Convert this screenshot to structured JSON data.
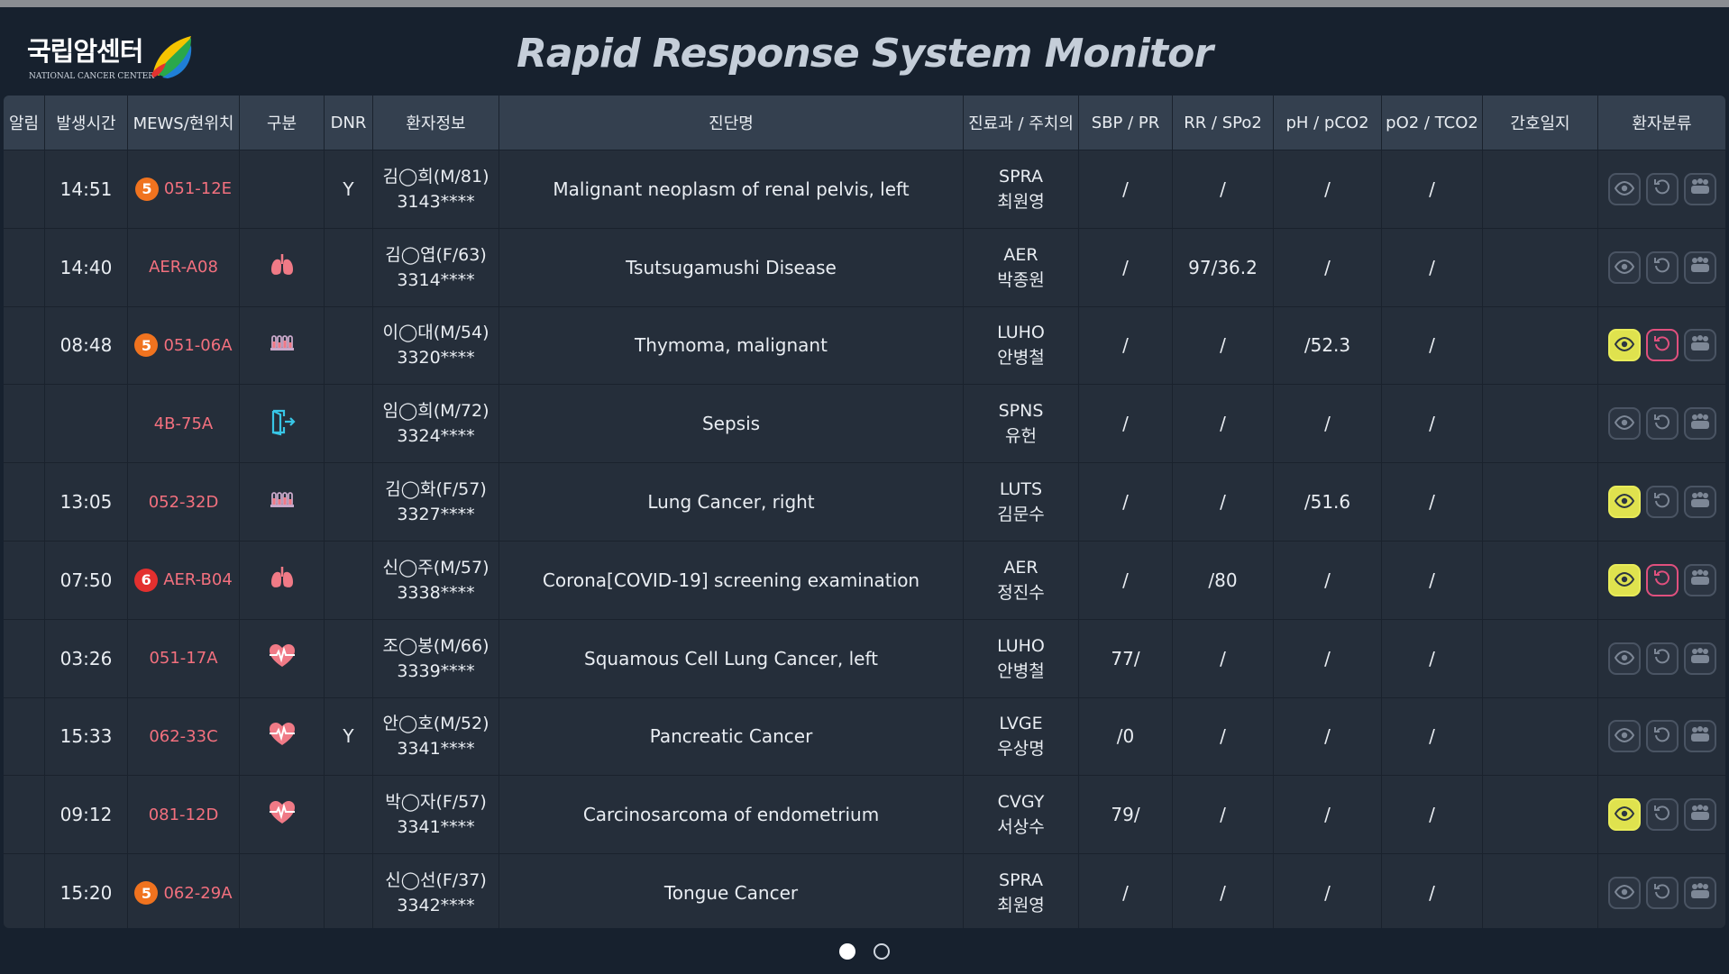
{
  "app": {
    "logo_ko": "국립암센터",
    "logo_en": "NATIONAL CANCER CENTER",
    "title": "Rapid Response System Monitor"
  },
  "colors": {
    "mews_orange": "#f0731f",
    "mews_red": "#e3302f",
    "location": "#f3707e",
    "eye_active": "#dfe24e",
    "reset_active": "#e0507e"
  },
  "columns": [
    "알림",
    "발생시간",
    "MEWS/현위치",
    "구분",
    "DNR",
    "환자정보",
    "진단명",
    "진료과 / 주치의",
    "SBP / PR",
    "RR / SPo2",
    "pH / pCO2",
    "pO2 / TCO2",
    "간호일지",
    "환자분류"
  ],
  "rows": [
    {
      "time": "14:51",
      "mews": "5",
      "mews_color": "orange",
      "location": "051-12E",
      "type_icon": "",
      "dnr": "Y",
      "patient": "김◯희(M/81)",
      "patient_id": "3143****",
      "diagnosis": "Malignant neoplasm of renal pelvis, left",
      "dept": "SPRA",
      "doctor": "최원영",
      "sbp_pr": "/",
      "rr_spo2": "/",
      "ph_pco2": "/",
      "po2_tco2": "/",
      "nursing": "",
      "eye_active": false,
      "reset_active": false
    },
    {
      "time": "14:40",
      "mews": "",
      "mews_color": "",
      "location": "AER-A08",
      "type_icon": "lungs-icon",
      "dnr": "",
      "patient": "김◯엽(F/63)",
      "patient_id": "3314****",
      "diagnosis": "Tsutsugamushi Disease",
      "dept": "AER",
      "doctor": "박종원",
      "sbp_pr": "/",
      "rr_spo2": "97/36.2",
      "ph_pco2": "/",
      "po2_tco2": "/",
      "nursing": "",
      "eye_active": false,
      "reset_active": false
    },
    {
      "time": "08:48",
      "mews": "5",
      "mews_color": "orange",
      "location": "051-06A",
      "type_icon": "test-tubes-icon",
      "dnr": "",
      "patient": "이◯대(M/54)",
      "patient_id": "3320****",
      "diagnosis": "Thymoma, malignant",
      "dept": "LUHO",
      "doctor": "안병철",
      "sbp_pr": "/",
      "rr_spo2": "/",
      "ph_pco2": "/52.3",
      "po2_tco2": "/",
      "nursing": "",
      "eye_active": true,
      "reset_active": true
    },
    {
      "time": "",
      "mews": "",
      "mews_color": "",
      "location": "4B-75A",
      "type_icon": "discharge-icon",
      "dnr": "",
      "patient": "임◯희(M/72)",
      "patient_id": "3324****",
      "diagnosis": "Sepsis",
      "dept": "SPNS",
      "doctor": "유헌",
      "sbp_pr": "/",
      "rr_spo2": "/",
      "ph_pco2": "/",
      "po2_tco2": "/",
      "nursing": "",
      "eye_active": false,
      "reset_active": false
    },
    {
      "time": "13:05",
      "mews": "",
      "mews_color": "",
      "location": "052-32D",
      "type_icon": "test-tubes-icon",
      "dnr": "",
      "patient": "김◯화(F/57)",
      "patient_id": "3327****",
      "diagnosis": "Lung Cancer, right",
      "dept": "LUTS",
      "doctor": "김문수",
      "sbp_pr": "/",
      "rr_spo2": "/",
      "ph_pco2": "/51.6",
      "po2_tco2": "/",
      "nursing": "",
      "eye_active": true,
      "reset_active": false
    },
    {
      "time": "07:50",
      "mews": "6",
      "mews_color": "red",
      "location": "AER-B04",
      "type_icon": "lungs-icon",
      "dnr": "",
      "patient": "신◯주(M/57)",
      "patient_id": "3338****",
      "diagnosis": "Corona[COVID-19] screening examination",
      "dept": "AER",
      "doctor": "정진수",
      "sbp_pr": "/",
      "rr_spo2": "/80",
      "ph_pco2": "/",
      "po2_tco2": "/",
      "nursing": "",
      "eye_active": true,
      "reset_active": true
    },
    {
      "time": "03:26",
      "mews": "",
      "mews_color": "",
      "location": "051-17A",
      "type_icon": "heart-pulse-icon",
      "dnr": "",
      "patient": "조◯봉(M/66)",
      "patient_id": "3339****",
      "diagnosis": "Squamous Cell Lung Cancer, left",
      "dept": "LUHO",
      "doctor": "안병철",
      "sbp_pr": "77/",
      "rr_spo2": "/",
      "ph_pco2": "/",
      "po2_tco2": "/",
      "nursing": "",
      "eye_active": false,
      "reset_active": false
    },
    {
      "time": "15:33",
      "mews": "",
      "mews_color": "",
      "location": "062-33C",
      "type_icon": "heart-pulse-icon",
      "dnr": "Y",
      "patient": "안◯호(M/52)",
      "patient_id": "3341****",
      "diagnosis": "Pancreatic Cancer",
      "dept": "LVGE",
      "doctor": "우상명",
      "sbp_pr": "/0",
      "rr_spo2": "/",
      "ph_pco2": "/",
      "po2_tco2": "/",
      "nursing": "",
      "eye_active": false,
      "reset_active": false
    },
    {
      "time": "09:12",
      "mews": "",
      "mews_color": "",
      "location": "081-12D",
      "type_icon": "heart-pulse-icon",
      "dnr": "",
      "patient": "박◯자(F/57)",
      "patient_id": "3341****",
      "diagnosis": "Carcinosarcoma of endometrium",
      "dept": "CVGY",
      "doctor": "서상수",
      "sbp_pr": "79/",
      "rr_spo2": "/",
      "ph_pco2": "/",
      "po2_tco2": "/",
      "nursing": "",
      "eye_active": true,
      "reset_active": false
    },
    {
      "time": "15:20",
      "mews": "5",
      "mews_color": "orange",
      "location": "062-29A",
      "type_icon": "",
      "dnr": "",
      "patient": "신◯선(F/37)",
      "patient_id": "3342****",
      "diagnosis": "Tongue Cancer",
      "dept": "SPRA",
      "doctor": "최원영",
      "sbp_pr": "/",
      "rr_spo2": "/",
      "ph_pco2": "/",
      "po2_tco2": "/",
      "nursing": "",
      "eye_active": false,
      "reset_active": false
    }
  ],
  "pager": {
    "pages": 2,
    "current": 1
  }
}
